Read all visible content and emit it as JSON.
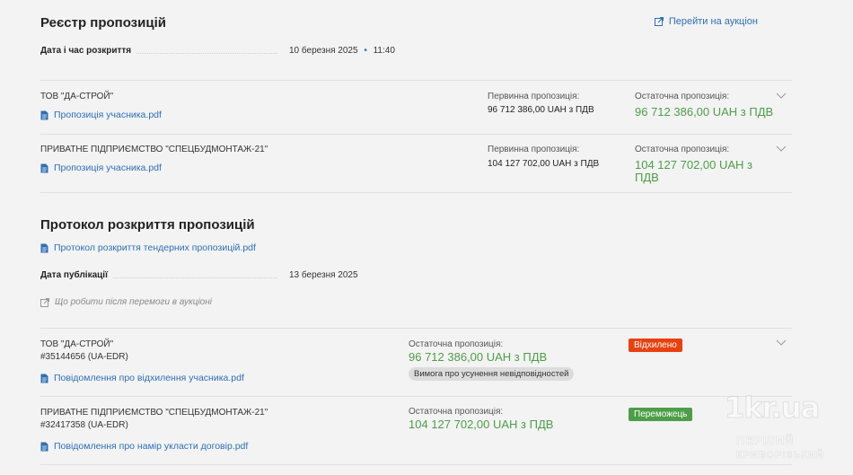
{
  "registry": {
    "title": "Реєстр пропозицій",
    "auction_link": "Перейти на аукціон",
    "open_label": "Дата і час розкриття",
    "open_date": "10 березня 2025",
    "open_sep": "•",
    "open_time": "11:40",
    "bids": [
      {
        "org": "ТОВ \"ДА-СТРОЙ\"",
        "file": "Пропозиція учасника.pdf",
        "initial_label": "Первинна пропозиція:",
        "initial_value": "96 712 386,00 UAH з ПДВ",
        "final_label": "Остаточна пропозиція:",
        "final_value": "96 712 386,00 UAH з ПДВ"
      },
      {
        "org": "ПРИВАТНЕ ПІДПРИЄМСТВО \"СПЕЦБУДМОНТАЖ-21\"",
        "file": "Пропозиція учасника.pdf",
        "initial_label": "Первинна пропозиція:",
        "initial_value": "104 127 702,00 UAH з ПДВ",
        "final_label": "Остаточна пропозиція:",
        "final_value_line1": "104 127 702,00 UAH з",
        "final_value_line2": "ПДВ"
      }
    ]
  },
  "protocol": {
    "title": "Протокол розкриття пропозицій",
    "file": "Протокол розкриття тендерних пропозицій.pdf",
    "pub_label": "Дата публікації",
    "pub_date": "13 березня 2025",
    "note": "Що робити після перемоги в аукціоні",
    "results": [
      {
        "org": "ТОВ \"ДА-СТРОЙ\"",
        "edr": "#35144656 (UA-EDR)",
        "file": "Повідомлення про відхилення учасника.pdf",
        "final_label": "Остаточна пропозиція:",
        "final_value": "96 712 386,00 UAH з ПДВ",
        "tag": "Вимога про усунення невідповідностей",
        "status": "Відхилено",
        "status_color": "#e8410f"
      },
      {
        "org": "ПРИВАТНЕ ПІДПРИЄМСТВО \"СПЕЦБУДМОНТАЖ-21\"",
        "edr": "#32417358 (UA-EDR)",
        "file": "Повідомлення про намір укласти договір.pdf",
        "final_label": "Остаточна пропозиція:",
        "final_value": "104 127 702,00 UAH з ПДВ",
        "status": "Переможець",
        "status_color": "#4d9e48"
      }
    ]
  },
  "watermark": {
    "logo": "1kr.ua",
    "line1": "ПЕРШИЙ",
    "line2": "КРИВОРІЗЬКИЙ"
  }
}
